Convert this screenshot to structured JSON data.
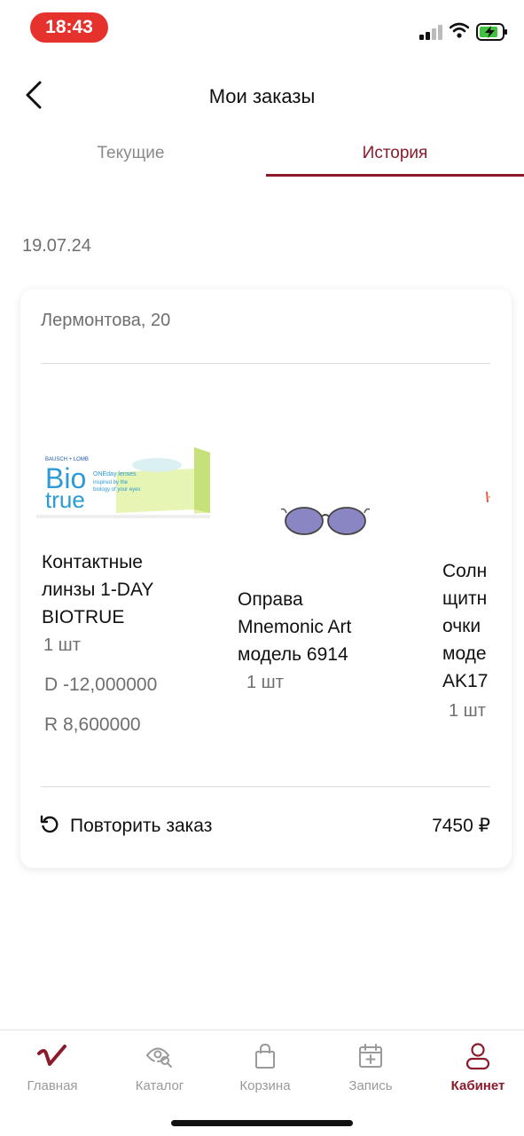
{
  "status_bar": {
    "time": "18:43",
    "signal_icon": "signal-icon",
    "wifi_icon": "wifi-icon",
    "battery_icon": "battery-charging-icon",
    "time_pill_color": "#e5322d"
  },
  "header": {
    "title": "Мои заказы",
    "back_icon": "chevron-left-icon"
  },
  "tabs": [
    {
      "label": "Текущие",
      "active": false
    },
    {
      "label": "История",
      "active": true
    }
  ],
  "order": {
    "date": "19.07.24",
    "store": "Лермонтова, 20",
    "products": [
      {
        "name": "Контактные\nлинзы 1-DAY\nBIOTRUE",
        "quantity": "1 шт",
        "params": [
          "D -12,000000",
          "R 8,600000"
        ],
        "image_text": {
          "brand": "BAUSCH + LOMB",
          "logo_line1": "Bio",
          "logo_line2": "true",
          "sub1": "ONEday lenses",
          "sub2": "inspired by the",
          "sub3": "biology of your eyes"
        }
      },
      {
        "name": "Оправа\nMnemonic Art\nмодель 6914",
        "quantity": "1 шт",
        "params": []
      },
      {
        "name": "Солн\nщитн\nочки\nмоде\nAK17",
        "quantity": "1 шт",
        "params": []
      }
    ],
    "repeat_label": "Повторить заказ",
    "repeat_icon": "repeat-icon",
    "total": "7450 ₽"
  },
  "bottom_nav": [
    {
      "label": "Главная",
      "icon": "brand-logo-icon",
      "active": false
    },
    {
      "label": "Каталог",
      "icon": "eye-search-icon",
      "active": false
    },
    {
      "label": "Корзина",
      "icon": "shopping-bag-icon",
      "active": false
    },
    {
      "label": "Запись",
      "icon": "calendar-plus-icon",
      "active": false
    },
    {
      "label": "Кабинет",
      "icon": "user-icon",
      "active": true
    }
  ],
  "colors": {
    "accent": "#8b1a2b",
    "muted_text": "#6f6f6f",
    "divider": "#dddddd"
  }
}
